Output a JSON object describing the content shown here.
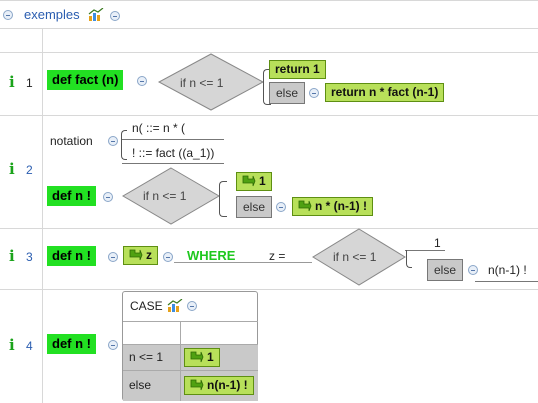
{
  "header": {
    "title": "exemples"
  },
  "rows": [
    {
      "num": "1",
      "def": "def fact (n)",
      "cond": "if n <= 1",
      "then": "return 1",
      "else_label": "else",
      "else_value": "return n * fact (n-1)"
    },
    {
      "num": "2",
      "notation_label": "notation",
      "notation_line1": "n( ::= n * (",
      "notation_line2": "! ::= fact ((a_1))",
      "def": "def n !",
      "cond": "if n <= 1",
      "then": "1",
      "else_label": "else",
      "else_value": "n * (n-1) !"
    },
    {
      "num": "3",
      "def": "def n !",
      "z_label": "z",
      "where": "WHERE",
      "z_eq": "z =",
      "cond": "if n <= 1",
      "then": "1",
      "else_label": "else",
      "else_value": "n(n-1) !"
    },
    {
      "num": "4",
      "def": "def n !",
      "case_title": "CASE",
      "case_rows": [
        {
          "cond": "n <= 1",
          "value": "1"
        },
        {
          "cond": "else",
          "value": "n(n-1) !"
        }
      ]
    }
  ],
  "colors": {
    "def_green": "#22e022",
    "expr_green": "#b8e05a",
    "else_gray": "#c9c9c9",
    "where_green": "#1fc81f",
    "title_blue": "#2a5db0"
  },
  "icons": [
    "info-icon",
    "chart-icon",
    "collapse-icon",
    "arrow-icon"
  ]
}
